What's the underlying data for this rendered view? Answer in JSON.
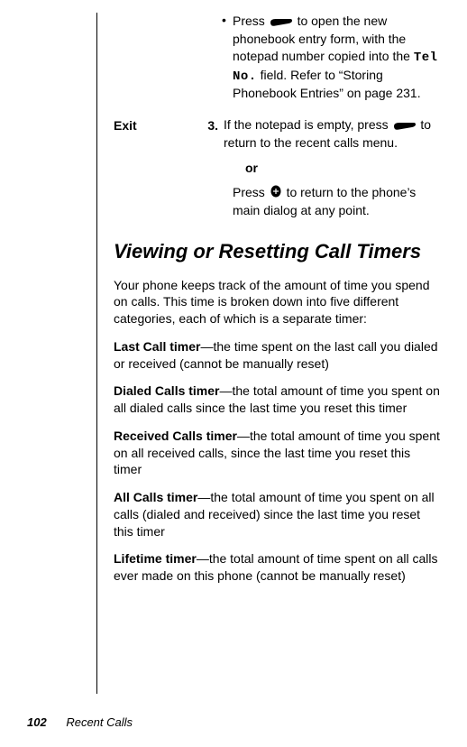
{
  "bullet1": {
    "prefix": "Press ",
    "after": " to open the new phonebook entry form, with the notepad number copied into the ",
    "mono": "Tel No.",
    "rest": " field. Refer to “Storing Phonebook Entries” on page 231."
  },
  "step3": {
    "label": "Exit",
    "num": "3.",
    "line1a": "If the notepad is empty, press ",
    "line1b": " to return to the recent calls menu.",
    "or": "or",
    "line2a": "Press ",
    "line2b": " to return to the phone’s main dialog at any point."
  },
  "heading": "Viewing or Resetting Call Timers",
  "intro": "Your phone keeps track of the amount of time you spend on calls. This time is broken down into five different categories, each of which is a separate timer:",
  "timers": [
    {
      "name": "Last Call timer",
      "desc": "—the time spent on the last call you dialed or received (cannot be manually reset)"
    },
    {
      "name": "Dialed Calls timer",
      "desc": "—the total amount of time you spent on all dialed calls since the last time you reset this timer"
    },
    {
      "name": "Received Calls timer",
      "desc": "—the total amount of time you spent on all received calls, since the last time you reset this timer"
    },
    {
      "name": "All Calls timer",
      "desc": "—the total amount of time you spent on all calls (dialed and received) since the last time you reset this timer"
    },
    {
      "name": "Lifetime timer",
      "desc": "—the total amount of time spent on all calls ever made on this phone (cannot be manually reset)"
    }
  ],
  "footer": {
    "page": "102",
    "chapter": "Recent Calls"
  }
}
